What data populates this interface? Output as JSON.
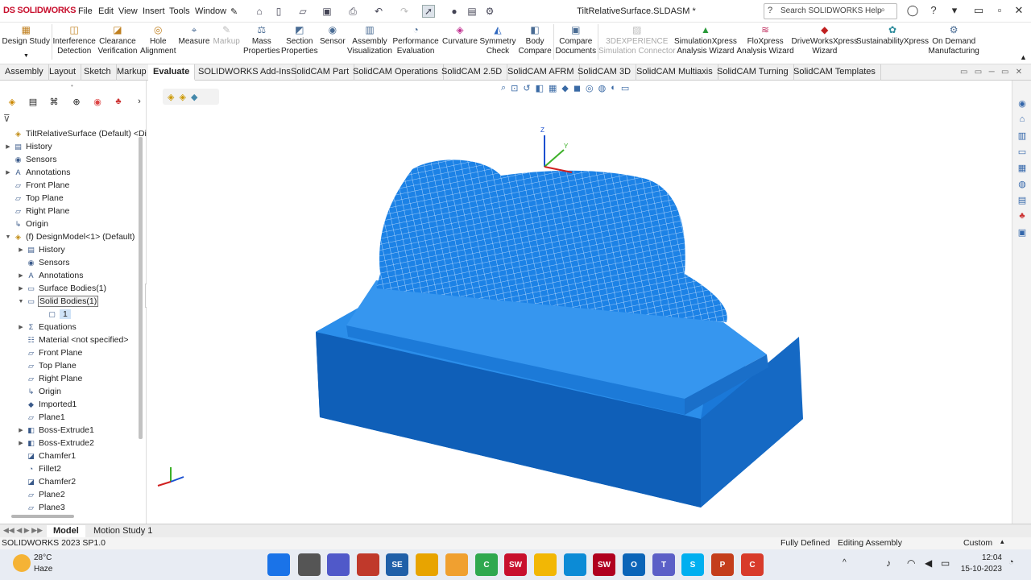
{
  "app": {
    "logo": "DS SOLIDWORKS",
    "menus": [
      "File",
      "Edit",
      "View",
      "Insert",
      "Tools",
      "Window"
    ],
    "document_title": "TiltRelativeSurface.SLDASM *",
    "search_placeholder": "Search SOLIDWORKS Help"
  },
  "commands": [
    {
      "label": "Design Study",
      "icon": "design-study"
    },
    {
      "label": "Interference\nDetection",
      "icon": "interference"
    },
    {
      "label": "Clearance\nVerification",
      "icon": "clearance"
    },
    {
      "label": "Hole\nAlignment",
      "icon": "hole"
    },
    {
      "label": "Measure",
      "icon": "measure"
    },
    {
      "label": "Markup",
      "icon": "markup",
      "disabled": true
    },
    {
      "label": "Mass\nProperties",
      "icon": "mass"
    },
    {
      "label": "Section\nProperties",
      "icon": "section"
    },
    {
      "label": "Sensor",
      "icon": "sensor"
    },
    {
      "label": "Assembly\nVisualization",
      "icon": "assembly-vis"
    },
    {
      "label": "Performance\nEvaluation",
      "icon": "performance"
    },
    {
      "label": "Curvature",
      "icon": "curvature"
    },
    {
      "label": "Symmetry\nCheck",
      "icon": "symmetry"
    },
    {
      "label": "Body\nCompare",
      "icon": "body-compare"
    },
    {
      "label": "Compare\nDocuments",
      "icon": "compare-docs"
    },
    {
      "label": "3DEXPERIENCE\nSimulation Connector",
      "icon": "3dx",
      "disabled": true
    },
    {
      "label": "SimulationXpress\nAnalysis Wizard",
      "icon": "simxpress"
    },
    {
      "label": "FloXpress\nAnalysis Wizard",
      "icon": "floxpress"
    },
    {
      "label": "DriveWorksXpress\nWizard",
      "icon": "driveworks"
    },
    {
      "label": "SustainabilityXpress",
      "icon": "sustainability"
    },
    {
      "label": "On Demand\nManufacturing",
      "icon": "manufacturing"
    }
  ],
  "tabs": [
    "Assembly",
    "Layout",
    "Sketch",
    "Markup",
    "Evaluate",
    "SOLIDWORKS Add-Ins",
    "SolidCAM Part",
    "SolidCAM Operations",
    "SolidCAM 2.5D",
    "SolidCAM AFRM",
    "SolidCAM 3D",
    "SolidCAM Multiaxis",
    "SolidCAM Turning",
    "SolidCAM Templates"
  ],
  "active_tab": "Evaluate",
  "tree": [
    {
      "label": "TiltRelativeSurface (Default) <Dis",
      "level": 0,
      "icon": "assembly-icon",
      "exp": ""
    },
    {
      "label": "History",
      "level": 1,
      "icon": "history-icon",
      "exp": "▶"
    },
    {
      "label": "Sensors",
      "level": 1,
      "icon": "sensor-icon",
      "exp": ""
    },
    {
      "label": "Annotations",
      "level": 1,
      "icon": "annotation-icon",
      "exp": "▶"
    },
    {
      "label": "Front Plane",
      "level": 1,
      "icon": "plane-icon",
      "exp": ""
    },
    {
      "label": "Top Plane",
      "level": 1,
      "icon": "plane-icon",
      "exp": ""
    },
    {
      "label": "Right Plane",
      "level": 1,
      "icon": "plane-icon",
      "exp": ""
    },
    {
      "label": "Origin",
      "level": 1,
      "icon": "origin-icon",
      "exp": ""
    },
    {
      "label": "(f) DesignModel<1> (Default)",
      "level": 0,
      "icon": "part-icon",
      "exp": "▼"
    },
    {
      "label": "History",
      "level": 2,
      "icon": "history-icon",
      "exp": "▶"
    },
    {
      "label": "Sensors",
      "level": 2,
      "icon": "sensor-icon",
      "exp": ""
    },
    {
      "label": "Annotations",
      "level": 2,
      "icon": "annotation-icon",
      "exp": "▶"
    },
    {
      "label": "Surface Bodies(1)",
      "level": 2,
      "icon": "folder-icon",
      "exp": "▶"
    },
    {
      "label": "Solid Bodies(1)",
      "level": 2,
      "icon": "folder-icon",
      "exp": "▼",
      "selected": true
    },
    {
      "label": "1",
      "level": 3,
      "icon": "body-icon",
      "exp": "",
      "highlight": true
    },
    {
      "label": "Equations",
      "level": 2,
      "icon": "equation-icon",
      "exp": "▶"
    },
    {
      "label": "Material <not specified>",
      "level": 2,
      "icon": "material-icon",
      "exp": ""
    },
    {
      "label": "Front Plane",
      "level": 2,
      "icon": "plane-icon",
      "exp": ""
    },
    {
      "label": "Top Plane",
      "level": 2,
      "icon": "plane-icon",
      "exp": ""
    },
    {
      "label": "Right Plane",
      "level": 2,
      "icon": "plane-icon",
      "exp": ""
    },
    {
      "label": "Origin",
      "level": 2,
      "icon": "origin-icon",
      "exp": ""
    },
    {
      "label": "Imported1",
      "level": 2,
      "icon": "imported-icon",
      "exp": ""
    },
    {
      "label": "Plane1",
      "level": 2,
      "icon": "plane-icon",
      "exp": ""
    },
    {
      "label": "Boss-Extrude1",
      "level": 2,
      "icon": "extrude-icon",
      "exp": "▶"
    },
    {
      "label": "Boss-Extrude2",
      "level": 2,
      "icon": "extrude-icon",
      "exp": "▶"
    },
    {
      "label": "Chamfer1",
      "level": 2,
      "icon": "chamfer-icon",
      "exp": ""
    },
    {
      "label": "Fillet2",
      "level": 2,
      "icon": "fillet-icon",
      "exp": ""
    },
    {
      "label": "Chamfer2",
      "level": 2,
      "icon": "chamfer-icon",
      "exp": ""
    },
    {
      "label": "Plane2",
      "level": 2,
      "icon": "plane-icon",
      "exp": ""
    },
    {
      "label": "Plane3",
      "level": 2,
      "icon": "plane-icon",
      "exp": ""
    }
  ],
  "triad": {
    "z": "Z",
    "y": "Y"
  },
  "bottom_tabs": [
    "Model",
    "Motion Study 1"
  ],
  "status": {
    "version": "SOLIDWORKS 2023 SP1.0",
    "state": "Fully Defined",
    "mode": "Editing Assembly",
    "units": "Custom"
  },
  "weather": {
    "temp": "28°C",
    "desc": "Haze"
  },
  "taskbar_apps": [
    {
      "name": "start",
      "color": "#1a73e8",
      "label": ""
    },
    {
      "name": "task-view",
      "color": "#555",
      "label": ""
    },
    {
      "name": "teams-meet",
      "color": "#5059c9",
      "label": ""
    },
    {
      "name": "calendar",
      "color": "#c0392b",
      "label": ""
    },
    {
      "name": "se",
      "color": "#1f5fa8",
      "label": "SE"
    },
    {
      "name": "chrome",
      "color": "#e8a400",
      "label": ""
    },
    {
      "name": "paint",
      "color": "#f0a030",
      "label": ""
    },
    {
      "name": "camtasia",
      "color": "#2fa84f",
      "label": "C"
    },
    {
      "name": "solidworks-2023",
      "color": "#c8102e",
      "label": "SW"
    },
    {
      "name": "explorer",
      "color": "#f2b705",
      "label": ""
    },
    {
      "name": "edge",
      "color": "#0c8bd6",
      "label": ""
    },
    {
      "name": "solidworks-2022",
      "color": "#b00020",
      "label": "SW"
    },
    {
      "name": "outlook",
      "color": "#0a64b8",
      "label": "O"
    },
    {
      "name": "teams",
      "color": "#5b5fc7",
      "label": "T"
    },
    {
      "name": "skype",
      "color": "#00aff0",
      "label": "S"
    },
    {
      "name": "powerpoint",
      "color": "#c43e1c",
      "label": "P"
    },
    {
      "name": "camtasia-rec",
      "color": "#d83b2b",
      "label": "C"
    }
  ],
  "clock": {
    "time": "12:04",
    "date": "15-10-2023"
  }
}
